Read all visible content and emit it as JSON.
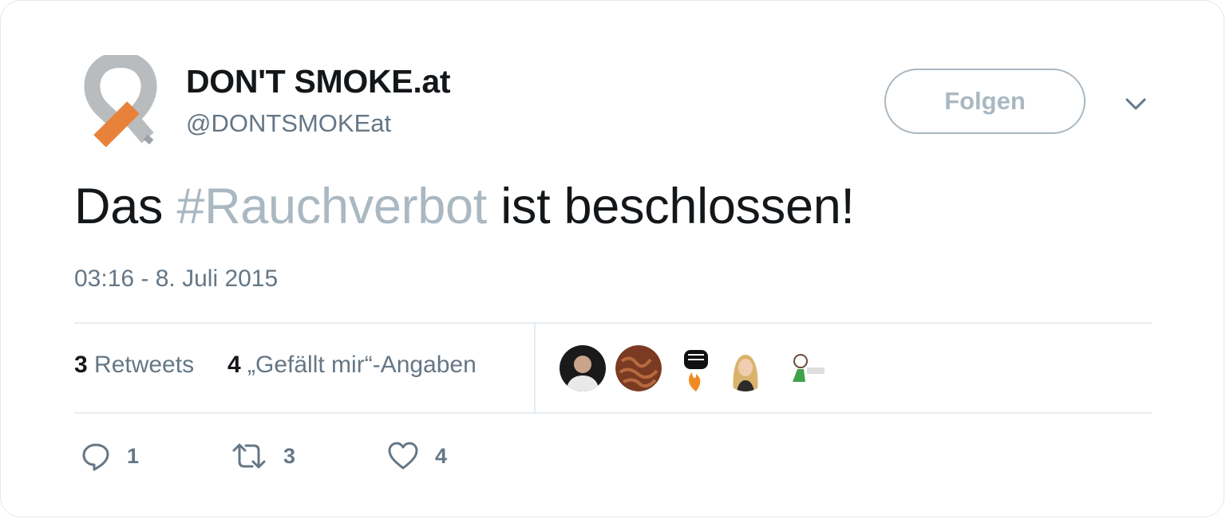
{
  "account": {
    "display_name": "DON'T SMOKE.at",
    "handle": "@DONTSMOKEat",
    "logo_icon": "grey-ribbon-orange-cigarette-logo"
  },
  "follow_button": {
    "label": "Folgen"
  },
  "menu": {
    "icon": "chevron-down-icon"
  },
  "tweet": {
    "text_before": "Das ",
    "hashtag": "#Rauchverbot",
    "text_after": " ist beschlossen!",
    "timestamp": "03:16 - 8. Juli 2015"
  },
  "stats": {
    "retweets_count": "3",
    "retweets_label": " Retweets",
    "likes_count": "4",
    "likes_label": " „Gefällt mir“-Angaben"
  },
  "likers": [
    {
      "icon": "avatar-man-dark-background"
    },
    {
      "icon": "avatar-brown-pattern"
    },
    {
      "icon": "avatar-raised-fist-flame"
    },
    {
      "icon": "avatar-blonde-woman"
    },
    {
      "icon": "avatar-small-cartoon-logo"
    }
  ],
  "actions": {
    "reply_count": "1",
    "retweet_count": "3",
    "like_count": "4"
  },
  "colors": {
    "text": "#14171a",
    "secondary": "#657786",
    "hashtag": "#aab8c2",
    "border": "#e6ecf0",
    "logo_orange": "#e8823a",
    "logo_grey": "#b9bcbf"
  }
}
